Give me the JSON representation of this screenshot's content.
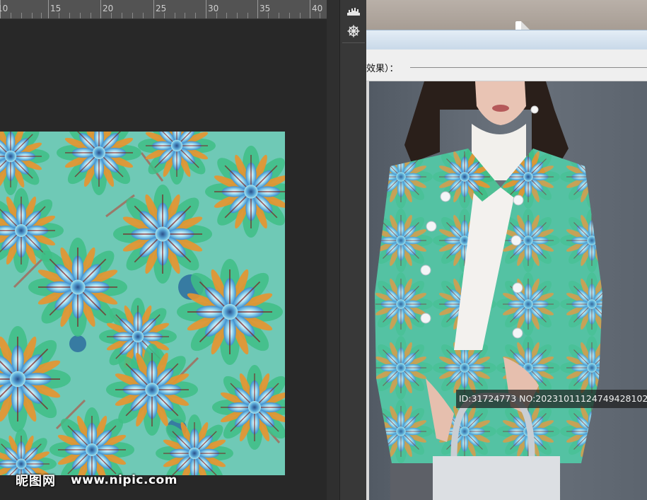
{
  "ruler": {
    "labels": [
      "10",
      "15",
      "20",
      "25",
      "30",
      "35",
      "40"
    ]
  },
  "watermark": {
    "logo": "昵图网",
    "url": "www.nipic.com"
  },
  "panel_strip": {
    "icons": [
      "histogram-icon",
      "navigator-icon"
    ]
  },
  "document": {
    "caption": "效果）：",
    "id_badge": "ID:31724773 NO:20231011124749428102"
  },
  "colors": {
    "workspace_bg": "#282828",
    "ruler_bg": "#535353",
    "panel_bg": "#383838",
    "pattern_blue": "#3d8fd0",
    "pattern_green": "#3fbf86",
    "pattern_orange": "#e8942e",
    "pattern_red": "#c0392b",
    "pattern_cyan": "#a8e6f0"
  }
}
